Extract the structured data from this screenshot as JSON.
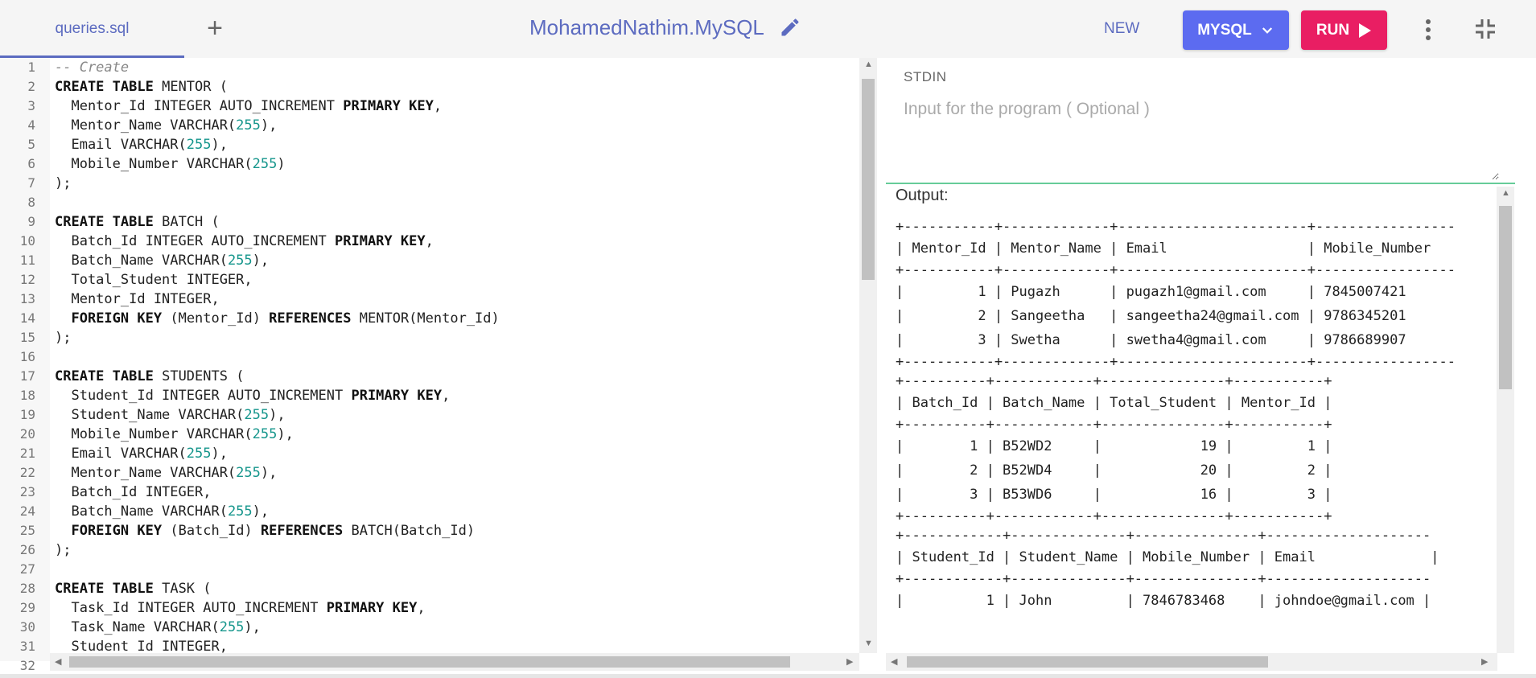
{
  "header": {
    "file_tab": "queries.sql",
    "add_tab_symbol": "+",
    "project_title": "MohamedNathim.MySQL",
    "new_label": "NEW",
    "language_label": "MYSQL",
    "run_label": "RUN"
  },
  "editor": {
    "lines": [
      "-- Create",
      "CREATE TABLE MENTOR (",
      "  Mentor_Id INTEGER AUTO_INCREMENT PRIMARY KEY,",
      "  Mentor_Name VARCHAR(255),",
      "  Email VARCHAR(255),",
      "  Mobile_Number VARCHAR(255)",
      ");",
      "",
      "CREATE TABLE BATCH (",
      "  Batch_Id INTEGER AUTO_INCREMENT PRIMARY KEY,",
      "  Batch_Name VARCHAR(255),",
      "  Total_Student INTEGER,",
      "  Mentor_Id INTEGER,",
      "  FOREIGN KEY (Mentor_Id) REFERENCES MENTOR(Mentor_Id)",
      ");",
      "",
      "CREATE TABLE STUDENTS (",
      "  Student_Id INTEGER AUTO_INCREMENT PRIMARY KEY,",
      "  Student_Name VARCHAR(255),",
      "  Mobile_Number VARCHAR(255),",
      "  Email VARCHAR(255),",
      "  Mentor_Name VARCHAR(255),",
      "  Batch_Id INTEGER,",
      "  Batch_Name VARCHAR(255),",
      "  FOREIGN KEY (Batch_Id) REFERENCES BATCH(Batch_Id)",
      ");",
      "",
      "CREATE TABLE TASK (",
      "  Task_Id INTEGER AUTO_INCREMENT PRIMARY KEY,",
      "  Task_Name VARCHAR(255),",
      "  Student_Id INTEGER,",
      ""
    ]
  },
  "stdin": {
    "label": "STDIN",
    "placeholder": "Input for the program ( Optional )"
  },
  "output": {
    "label": "Output:",
    "lines": [
      "+-----------+-------------+-----------------------+-----------------",
      "| Mentor_Id | Mentor_Name | Email                 | Mobile_Number",
      "+-----------+-------------+-----------------------+-----------------",
      "|         1 | Pugazh      | pugazh1@gmail.com     | 7845007421",
      "|         2 | Sangeetha   | sangeetha24@gmail.com | 9786345201",
      "|         3 | Swetha      | swetha4@gmail.com     | 9786689907",
      "+-----------+-------------+-----------------------+-----------------",
      "+----------+------------+---------------+-----------+",
      "| Batch_Id | Batch_Name | Total_Student | Mentor_Id |",
      "+----------+------------+---------------+-----------+",
      "|        1 | B52WD2     |            19 |         1 |",
      "|        2 | B52WD4     |            20 |         2 |",
      "|        3 | B53WD6     |            16 |         3 |",
      "+----------+------------+---------------+-----------+",
      "+------------+--------------+---------------+--------------------",
      "| Student_Id | Student_Name | Mobile_Number | Email              |",
      "+------------+--------------+---------------+--------------------",
      "|          1 | John         | 7846783468    | johndoe@gmail.com |"
    ]
  },
  "colors": {
    "accent": "#5c6bc0",
    "run": "#e91e63",
    "language_button": "#5c6bf0",
    "divider": "#66cc99"
  },
  "icons": {
    "edit": "pencil-icon",
    "language_dropdown": "chevron-down-icon",
    "run": "play-icon",
    "more": "kebab-menu-icon",
    "collapse": "collapse-icon"
  }
}
